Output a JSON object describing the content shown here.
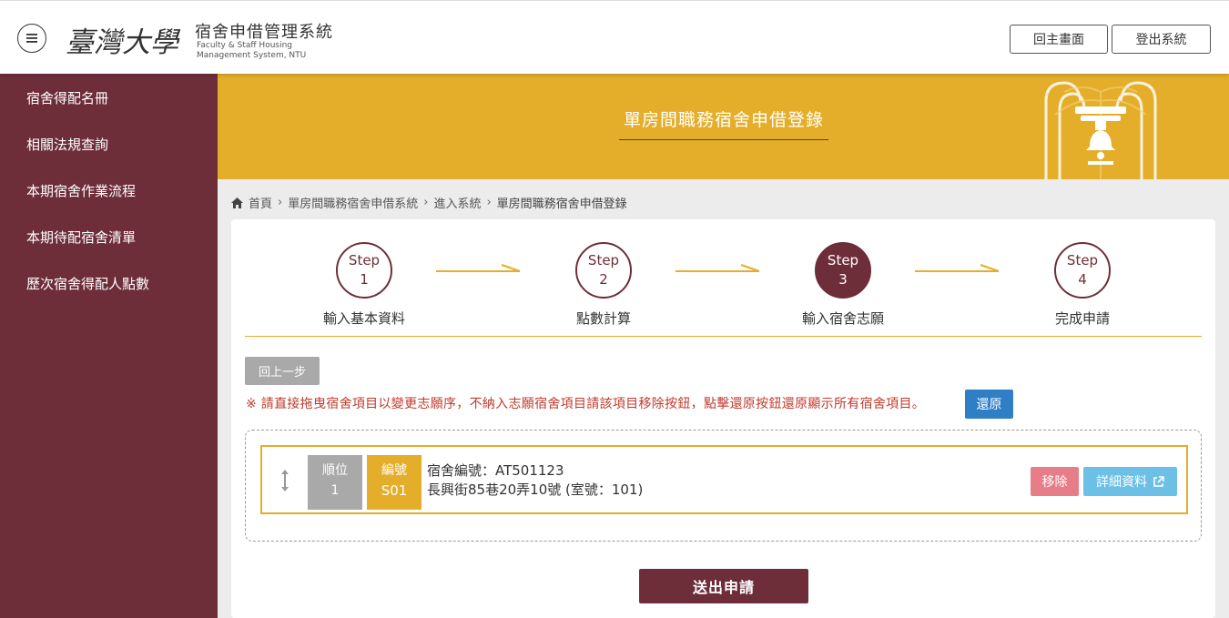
{
  "header": {
    "logo_text": "臺灣大學",
    "system_title": "宿舍申借管理系統",
    "system_subtitle_line1": "Faculty & Staff Housing",
    "system_subtitle_line2": "Management System, NTU",
    "home_button": "回主畫面",
    "logout_button": "登出系統"
  },
  "sidebar": {
    "items": [
      {
        "label": "宿舍得配名冊"
      },
      {
        "label": "相關法規查詢"
      },
      {
        "label": "本期宿舍作業流程"
      },
      {
        "label": "本期待配宿舍清單"
      },
      {
        "label": "歷次宿舍得配人點數"
      }
    ]
  },
  "banner": {
    "title": "單房間職務宿舍申借登錄"
  },
  "breadcrumb": {
    "items": [
      "首頁",
      "單房間職務宿舍申借系統",
      "進入系統",
      "單房間職務宿舍申借登錄"
    ]
  },
  "steps": [
    {
      "word": "Step",
      "num": "1",
      "label": "輸入基本資料",
      "active": false
    },
    {
      "word": "Step",
      "num": "2",
      "label": "點數計算",
      "active": false
    },
    {
      "word": "Step",
      "num": "3",
      "label": "輸入宿舍志願",
      "active": true
    },
    {
      "word": "Step",
      "num": "4",
      "label": "完成申請",
      "active": false
    }
  ],
  "actions": {
    "back_button": "回上一步",
    "notice": "※ 請直接拖曳宿舍項目以變更志願序，不納入志願宿舍項目請該項目移除按鈕，點擊還原按鈕還原顯示所有宿舍項目。",
    "reset_button": "還原",
    "submit_button": "送出申請"
  },
  "dorm_item": {
    "rank_label": "順位",
    "rank_value": "1",
    "code_label": "編號",
    "code_value": "S01",
    "dorm_id_line": "宿舍編號：AT501123",
    "address_line": "長興街85巷20弄10號 (室號：101)",
    "remove_button": "移除",
    "detail_button": "詳細資料"
  },
  "colors": {
    "maroon": "#6e2e39",
    "gold": "#e4ae2a",
    "blue": "#2f7fc7",
    "pink": "#e87d8a",
    "light_blue": "#6cc0e5",
    "gray": "#a9a9a9"
  },
  "icons": {
    "menu": "hamburger-menu-icon",
    "home": "home-icon",
    "drag": "drag-handle-icon",
    "external": "external-link-icon"
  }
}
